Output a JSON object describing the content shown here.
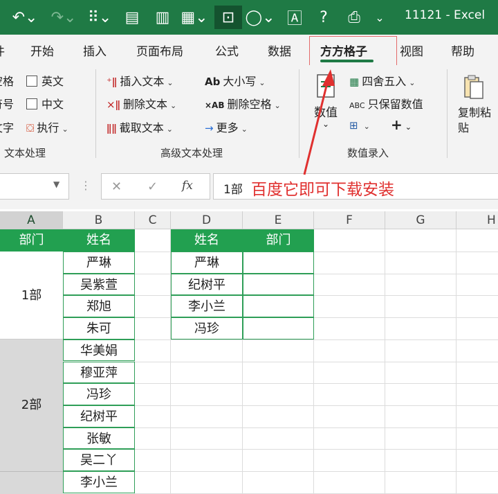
{
  "title_bar": {
    "quick_access": [
      {
        "name": "undo-icon",
        "glyph": "↶⌄"
      },
      {
        "name": "redo-icon",
        "glyph": "↷⌄"
      },
      {
        "name": "borders-icon",
        "glyph": "⠿⌄"
      },
      {
        "name": "form-icon",
        "glyph": "▤"
      },
      {
        "name": "chart-icon",
        "glyph": "▥"
      },
      {
        "name": "pivot-icon",
        "glyph": "▦⌄"
      },
      {
        "name": "camera-icon",
        "glyph": "⊡"
      },
      {
        "name": "shapes-icon",
        "glyph": "◯⌄"
      },
      {
        "name": "textbox-icon",
        "glyph": "🄰"
      },
      {
        "name": "help-icon",
        "glyph": "?"
      },
      {
        "name": "print-preview-icon",
        "glyph": "⎙"
      },
      {
        "name": "customize-icon",
        "glyph": "⌄"
      }
    ],
    "doc_title": "11121  -  Excel"
  },
  "tabs": [
    "开始",
    "插入",
    "页面布局",
    "公式",
    "数据",
    "方方格子",
    "视图",
    "帮助"
  ],
  "tab_partial_left": "件",
  "active_tab": "方方格子",
  "ribbon": {
    "group1": {
      "partial_items": [
        "空格",
        "符号",
        "文字"
      ],
      "items": [
        "英文",
        "中文",
        "执行"
      ],
      "label": "文本处理"
    },
    "group2": {
      "col1": [
        "插入文本",
        "删除文本",
        "截取文本"
      ],
      "col2": [
        "大小写",
        "删除空格",
        "更多"
      ],
      "col2_prefixes": [
        "Ab",
        "×AB",
        "→"
      ],
      "label": "高级文本处理"
    },
    "group3": {
      "big_button": "数值",
      "items": [
        "四舍五入",
        "只保留数值"
      ],
      "abc_prefix": "ABC",
      "label": "数值录入"
    },
    "group4": {
      "big_button": "复制粘贴"
    }
  },
  "formula_bar": {
    "cancel_glyph": "✕",
    "enter_glyph": "✓",
    "fx_glyph": "fx",
    "value": "1部",
    "annotation": "百度它即可下载安装",
    "annotation_color": "#e0302f"
  },
  "columns": [
    "A",
    "B",
    "C",
    "D",
    "E",
    "F",
    "G",
    "H"
  ],
  "sheet": {
    "A1": "部门",
    "B1": "姓名",
    "B_names": [
      "严琳",
      "吴紫萱",
      "郑旭",
      "朱可",
      "华美娟",
      "穆亚萍",
      "冯珍",
      "纪树平",
      "张敏",
      "吴二丫",
      "李小兰"
    ],
    "departments": [
      "1部",
      "2部"
    ],
    "D1": "姓名",
    "E1": "部门",
    "D_names": [
      "严琳",
      "纪树平",
      "李小兰",
      "冯珍"
    ]
  },
  "colors": {
    "excel_green": "#1f7a45",
    "header_green": "#22a050",
    "merged_grey": "#d9d9d9"
  }
}
